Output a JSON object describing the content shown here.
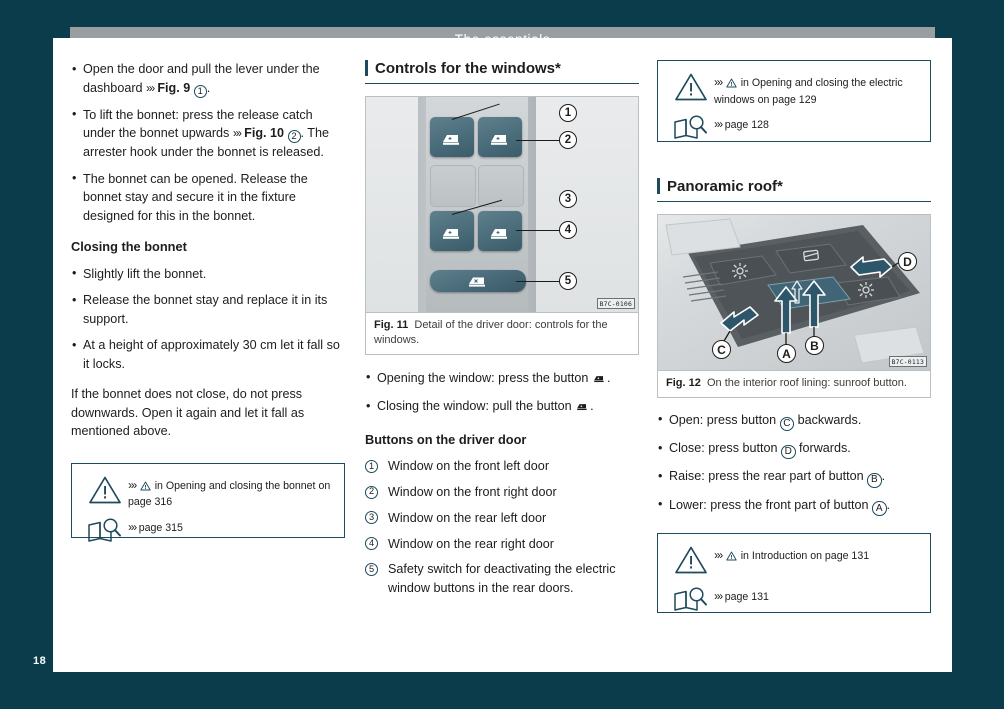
{
  "document": {
    "header_title": "The essentials",
    "page_number": "18"
  },
  "column_left": {
    "bullets": [
      {
        "pre": "Open the door and pull the lever under the dashboard ",
        "chev": "›››",
        "fig": "Fig. 9",
        "circle": "1",
        "post": "."
      },
      {
        "pre": "To lift the bonnet: press the release catch under the bonnet upwards ",
        "chev": "›››",
        "fig": "Fig. 10",
        "circle": "2",
        "post": ". The arrester hook under the bonnet is released."
      },
      {
        "pre": "The bonnet can be opened. Release the bonnet stay and secure it in the fixture designed for this in the bonnet.",
        "chev": "",
        "fig": "",
        "circle": "",
        "post": ""
      }
    ],
    "sub_head": "Closing the bonnet",
    "closing_bullets": [
      "Slightly lift the bonnet.",
      "Release the bonnet stay and replace it in its support.",
      "At a height of approximately 30 cm let it fall so it locks."
    ],
    "paragraph": "If the bonnet does not close, do not press downwards. Open it again and let it fall as mentioned above.",
    "info_box": {
      "warning_chev": "›››",
      "warning_text": "in Opening and closing the bonnet on page 316",
      "ref_chev": "›››",
      "ref_text": "page 315"
    }
  },
  "column_middle": {
    "section_head": "Controls for the windows*",
    "figure": {
      "code": "B7C-0106",
      "caption_label": "Fig. 11",
      "caption_text": "Detail of the driver door: controls for the windows.",
      "callouts": [
        "1",
        "2",
        "3",
        "4",
        "5"
      ]
    },
    "bullets": [
      {
        "pre": "Opening the window: press the button ",
        "post": "."
      },
      {
        "pre": "Closing the window: pull the button ",
        "post": "."
      }
    ],
    "sub_head": "Buttons on the driver door",
    "numbered_items": [
      {
        "num": "1",
        "text": "Window on the front left door"
      },
      {
        "num": "2",
        "text": "Window on the front right door"
      },
      {
        "num": "3",
        "text": "Window on the rear left door"
      },
      {
        "num": "4",
        "text": "Window on the rear right door"
      },
      {
        "num": "5",
        "text": "Safety switch for deactivating the electric window buttons in the rear doors."
      }
    ]
  },
  "column_right": {
    "info_box_top": {
      "warning_chev": "›››",
      "warning_text": "in Opening and closing the electric windows on page 129",
      "ref_chev": "›››",
      "ref_text": "page 128"
    },
    "section_head": "Panoramic roof*",
    "figure": {
      "code": "B7C-0113",
      "caption_label": "Fig. 12",
      "caption_text": "On the interior roof lining: sunroof button.",
      "callouts": [
        "A",
        "B",
        "C",
        "D"
      ]
    },
    "bullets": [
      {
        "pre": "Open: press button ",
        "circle": "C",
        "post": " backwards."
      },
      {
        "pre": "Close: press button ",
        "circle": "D",
        "post": " forwards."
      },
      {
        "pre": "Raise: press the rear part of button ",
        "circle": "B",
        "post": "."
      },
      {
        "pre": "Lower: press the front part of button ",
        "circle": "A",
        "post": "."
      }
    ],
    "info_box_bottom": {
      "warning_chev": "›››",
      "warning_text": "in Introduction on page 131",
      "ref_chev": "›››",
      "ref_text": "page 131"
    }
  },
  "colors": {
    "page_background": "#0b3c4c",
    "header_band": "#9a9ea2",
    "accent": "#1d4a5c",
    "text": "#1d1d1b",
    "button": "#4a6d7b"
  }
}
